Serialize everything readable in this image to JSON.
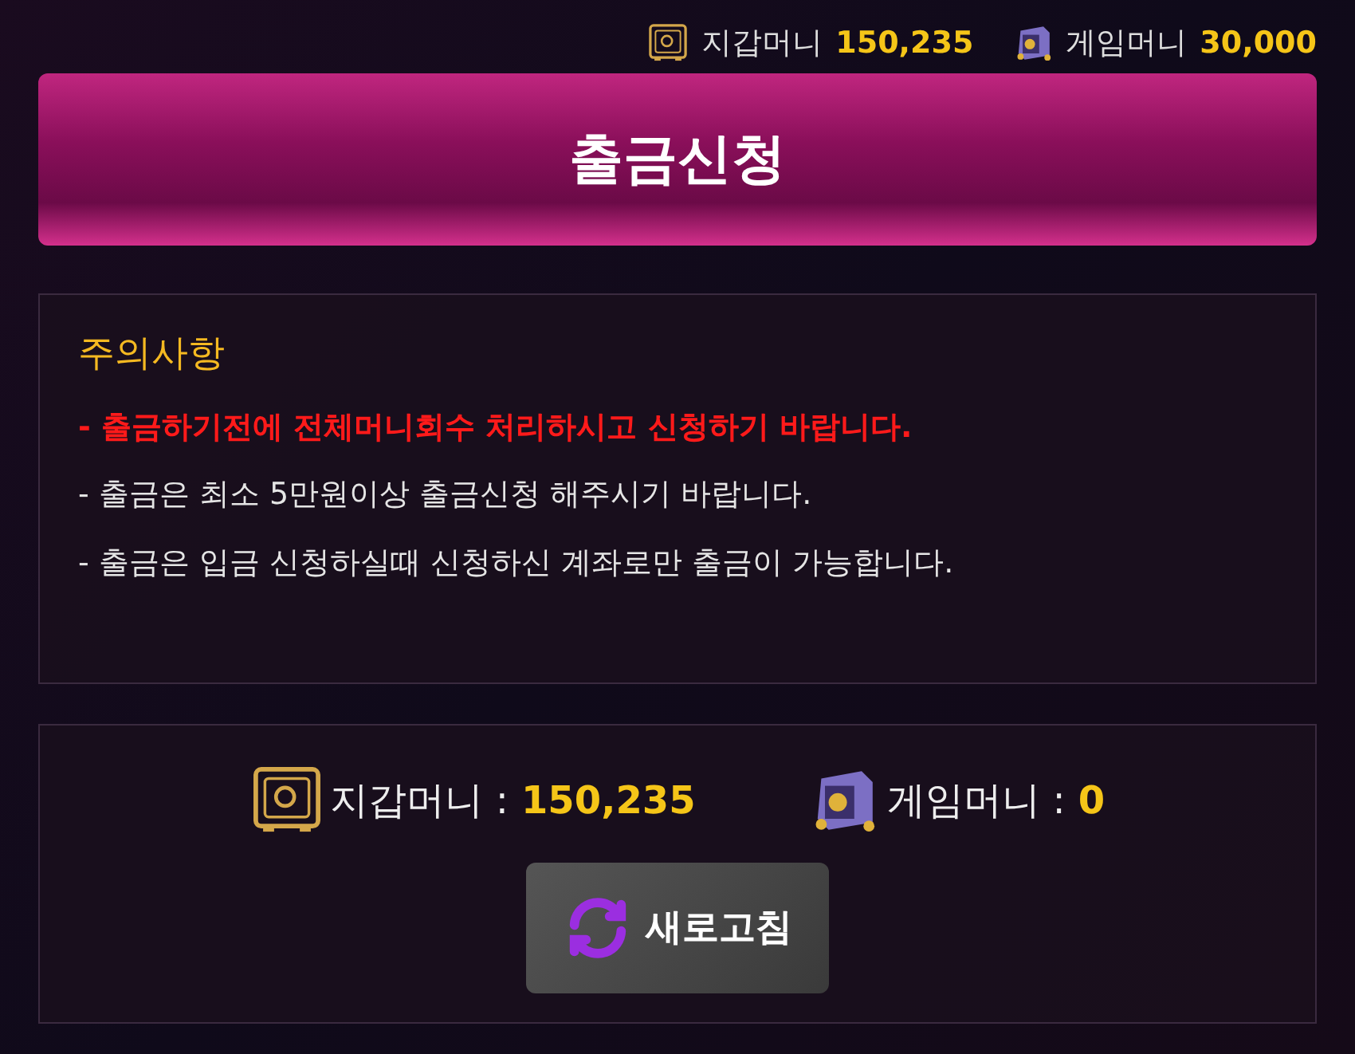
{
  "header_balances": [
    {
      "kind": "wallet",
      "label": "지갑머니",
      "amount": "150,235"
    },
    {
      "kind": "game",
      "label": "게임머니",
      "amount": "30,000"
    }
  ],
  "title": "출금신청",
  "notice": {
    "heading": "주의사항",
    "lines": [
      {
        "text": "- 출금하기전에 전체머니회수 처리하시고 신청하기 바랍니다.",
        "emphasis": true
      },
      {
        "text": "- 출금은 최소 5만원이상 출금신청 해주시기 바랍니다.",
        "emphasis": false
      },
      {
        "text": "- 출금은 입금 신청하실때 신청하신 계좌로만 출금이 가능합니다.",
        "emphasis": false
      }
    ]
  },
  "balances": [
    {
      "kind": "wallet",
      "label": "지갑머니",
      "separator": ":",
      "amount": "150,235"
    },
    {
      "kind": "game",
      "label": "게임머니",
      "separator": ":",
      "amount": "0"
    }
  ],
  "refresh_button": "새로고침"
}
